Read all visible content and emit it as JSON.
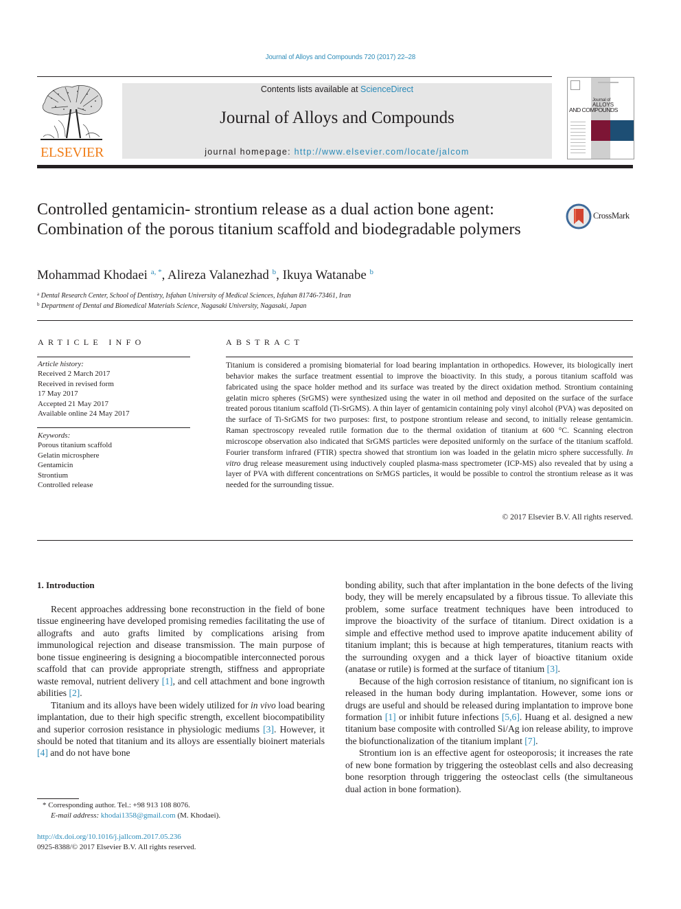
{
  "running_head": "Journal of Alloys and Compounds 720 (2017) 22–28",
  "masthead": {
    "contents_prefix": "Contents lists available at ",
    "contents_link": "ScienceDirect",
    "journal_name": "Journal of Alloys and Compounds",
    "homepage_prefix": "journal homepage: ",
    "homepage_url": "http://www.elsevier.com/locate/jalcom",
    "publisher_logo_text": "ELSEVIER",
    "cover": {
      "line1": "Journal of",
      "line2": "ALLOYS",
      "line3": "AND COMPOUNDS"
    }
  },
  "article": {
    "title": "Controlled gentamicin- strontium release as a dual action bone agent: Combination of the porous titanium scaffold and biodegradable polymers",
    "crossmark_label": "CrossMark",
    "authors": [
      {
        "name": "Mohammad Khodaei",
        "sup": "a, *",
        "sep": ", "
      },
      {
        "name": "Alireza Valanezhad",
        "sup": "b",
        "sep": ", "
      },
      {
        "name": "Ikuya Watanabe",
        "sup": "b",
        "sep": ""
      }
    ],
    "affiliations": [
      {
        "mark": "a",
        "text": "Dental Research Center, School of Dentistry, Isfahan University of Medical Sciences, Isfahan 81746-73461, Iran"
      },
      {
        "mark": "b",
        "text": "Department of Dental and Biomedical Materials Science, Nagasaki University, Nagasaki, Japan"
      }
    ]
  },
  "article_info": {
    "heading": "ARTICLE INFO",
    "history_label": "Article history:",
    "history": [
      "Received 2 March 2017",
      "Received in revised form",
      "17 May 2017",
      "Accepted 21 May 2017",
      "Available online 24 May 2017"
    ],
    "keywords_label": "Keywords:",
    "keywords": [
      "Porous titanium scaffold",
      "Gelatin microsphere",
      "Gentamicin",
      "Strontium",
      "Controlled release"
    ]
  },
  "abstract": {
    "heading": "ABSTRACT",
    "text_before_italic": "Titanium is considered a promising biomaterial for load bearing implantation in orthopedics. However, its biologically inert behavior makes the surface treatment essential to improve the bioactivity. In this study, a porous titanium scaffold was fabricated using the space holder method and its surface was treated by the direct oxidation method. Strontium containing gelatin micro spheres (SrGMS) were synthesized using the water in oil method and deposited on the surface of the surface treated porous titanium scaffold (Ti-SrGMS). A thin layer of gentamicin containing poly vinyl alcohol (PVA) was deposited on the surface of Ti-SrGMS for two purposes: first, to postpone strontium release and second, to initially release gentamicin. Raman spectroscopy revealed rutile formation due to the thermal oxidation of titanium at 600 °C. Scanning electron microscope observation also indicated that SrGMS particles were deposited uniformly on the surface of the titanium scaffold. Fourier transform infrared (FTIR) spectra showed that strontium ion was loaded in the gelatin micro sphere successfully. ",
    "italic": "In vitro",
    "text_after_italic": " drug release measurement using inductively coupled plasma-mass spectrometer (ICP-MS) also revealed that by using a layer of PVA with different concentrations on SrMGS particles, it would be possible to control the strontium release as it was needed for the surrounding tissue.",
    "copyright": "© 2017 Elsevier B.V. All rights reserved."
  },
  "body": {
    "section_heading": "1.  Introduction",
    "left_p1": [
      {
        "t": "Recent approaches addressing bone reconstruction in the field of bone tissue engineering have developed promising remedies facilitating the use of allografts and auto grafts limited by compli­cations arising from immunological rejection and disease trans­mission. The main purpose of bone tissue engineering is designing a biocompatible interconnected porous scaffold that can provide appropriate strength, stiffness and appropriate waste removal, nutrient delivery "
      },
      {
        "ref": "[1]"
      },
      {
        "t": ", and cell attachment and bone ingrowth abilities "
      },
      {
        "ref": "[2]"
      },
      {
        "t": "."
      }
    ],
    "left_p2": [
      {
        "t": "Titanium and its alloys have been widely utilized for "
      },
      {
        "i": "in vivo"
      },
      {
        "t": " load bearing implantation, due to their high specific strength, excellent biocompatibility and superior corrosion resistance in physiologic mediums "
      },
      {
        "ref": "[3]"
      },
      {
        "t": ". However, it should be noted that titanium and its alloys are essentially bioinert materials "
      },
      {
        "ref": "[4]"
      },
      {
        "t": " and do not have bone"
      }
    ],
    "right_p1": [
      {
        "t": "bonding ability, such that after implantation in the bone defects of the living body, they will be merely encapsulated by a fibrous tis­sue. To alleviate this problem, some surface treatment techniques have been introduced to improve the bioactivity of the surface of titanium. Direct oxidation is a simple and effective method used to improve apatite inducement ability of titanium implant; this is because at high temperatures, titanium reacts with the surround­ing oxygen and a thick layer of bioactive titanium oxide (anatase or rutile) is formed at the surface of titanium "
      },
      {
        "ref": "[3]"
      },
      {
        "t": "."
      }
    ],
    "right_p2": [
      {
        "t": "Because of the high corrosion resistance of titanium, no signif­icant ion is released in the human body during implantation. However, some ions or drugs are useful and should be released during implantation to improve bone formation "
      },
      {
        "ref": "[1]"
      },
      {
        "t": " or inhibit future infections "
      },
      {
        "ref": "[5,6]"
      },
      {
        "t": ". Huang et al. designed a new titanium base com­posite with controlled Si/Ag ion release ability, to improve the bio­functionalization of the titanium implant "
      },
      {
        "ref": "[7]"
      },
      {
        "t": "."
      }
    ],
    "right_p3": [
      {
        "t": "Strontium ion is an effective agent for osteoporosis; it increases the rate of new bone formation by triggering the osteoblast cells and also decreasing bone resorption through triggering the osteo­clast cells (the simultaneous dual action in bone formation)."
      }
    ]
  },
  "footnote": {
    "star": "*",
    "corresponding": "Corresponding author. Tel.: +98 913 108 8076.",
    "email_label": "E-mail address:",
    "email": "khodai1358@gmail.com",
    "email_suffix": " (M. Khodaei).",
    "doi": "http://dx.doi.org/10.1016/j.jallcom.2017.05.236",
    "issn_line": "0925-8388/© 2017 Elsevier B.V. All rights reserved."
  },
  "colors": {
    "link": "#2a8ab8",
    "elsevier_orange": "#f07d17",
    "masthead_gray": "#e6e6e6",
    "cover_red": "#7d1535",
    "cover_blue": "#1d4e74"
  }
}
